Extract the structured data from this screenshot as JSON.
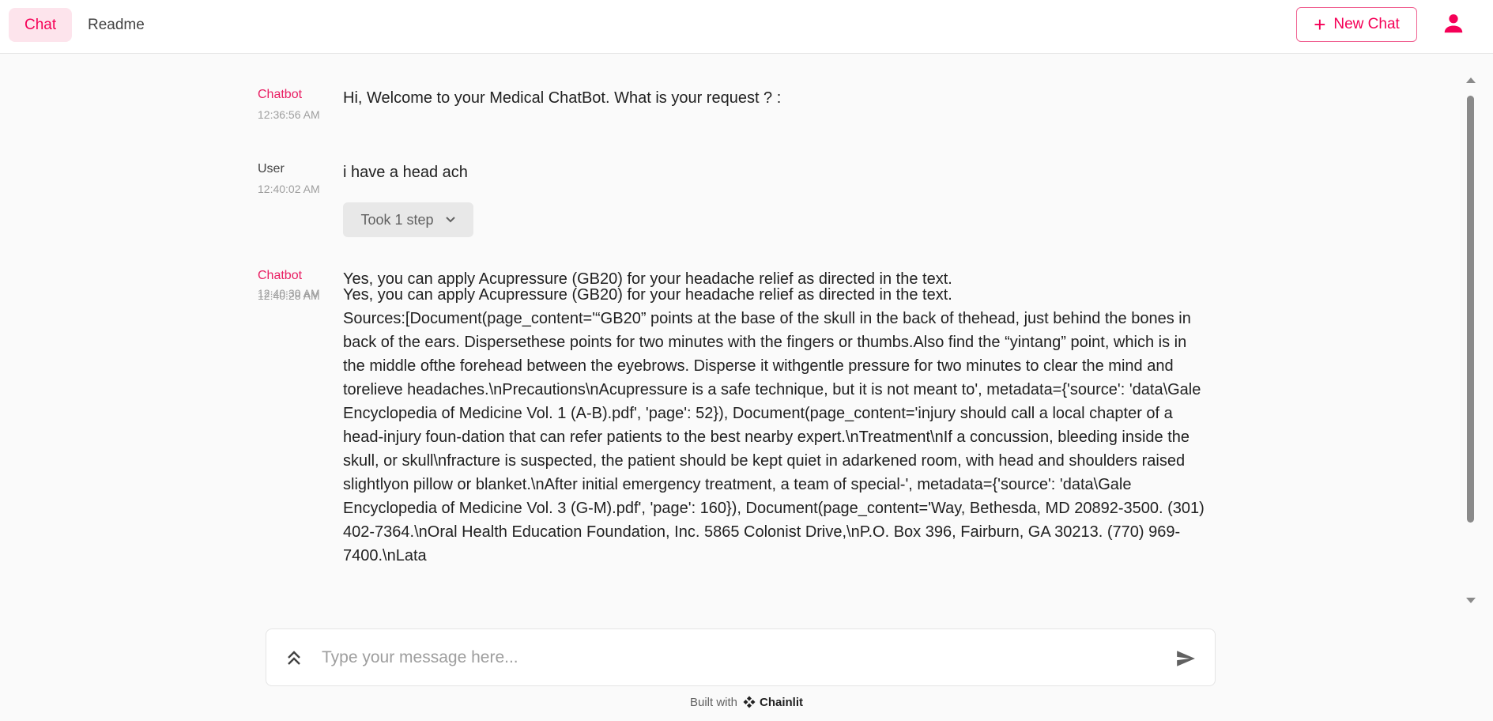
{
  "header": {
    "tabs": [
      {
        "label": "Chat",
        "active": true
      },
      {
        "label": "Readme",
        "active": false
      }
    ],
    "new_chat_label": "New Chat",
    "accent_color": "#f50057"
  },
  "messages": [
    {
      "author": "Chatbot",
      "time": "12:36:56 AM",
      "text": "Hi, Welcome to your Medical ChatBot. What is your request ? :"
    },
    {
      "author": "User",
      "time": "12:40:02 AM",
      "text": "i have a head ach",
      "step_label": "Took 1 step"
    },
    {
      "author": "Chatbot",
      "time": "12:40:28 AM",
      "text": "Yes, you can apply Acupressure (GB20) for your headache relief as directed in the text."
    },
    {
      "author": "",
      "time": "12:40:30 AM",
      "text": "Yes, you can apply Acupressure (GB20) for your headache relief as directed in the text.\nSources:[Document(page_content='“GB20” points at the base of the skull in the back of thehead, just behind the bones in back of the ears. Dispersethese points for two minutes with the fingers or thumbs.Also find the “yintang” point, which is in the middle ofthe forehead between the eyebrows. Disperse it withgentle pressure for two minutes to clear the mind and torelieve headaches.\\nPrecautions\\nAcupressure is a safe technique, but it is not meant to', metadata={'source': 'data\\Gale Encyclopedia of Medicine Vol. 1 (A-B).pdf', 'page': 52}), Document(page_content='injury should call a local chapter of a head-injury foun-dation that can refer patients to the best nearby expert.\\nTreatment\\nIf a concussion, bleeding inside the skull, or skull\\nfracture is suspected, the patient should be kept quiet in adarkened room, with head and shoulders raised slightlyon pillow or blanket.\\nAfter initial emergency treatment, a team of special-', metadata={'source': 'data\\Gale Encyclopedia of Medicine Vol. 3 (G-M).pdf', 'page': 160}), Document(page_content='Way, Bethesda, MD 20892-3500. (301) 402-7364.\\nOral Health Education Foundation, Inc. 5865 Colonist Drive,\\nP.O. Box 396, Fairburn, GA 30213. (770) 969-7400.\\nLata"
    }
  ],
  "composer": {
    "placeholder": "Type your message here..."
  },
  "footer": {
    "built_with": "Built with",
    "brand": "Chainlit"
  }
}
